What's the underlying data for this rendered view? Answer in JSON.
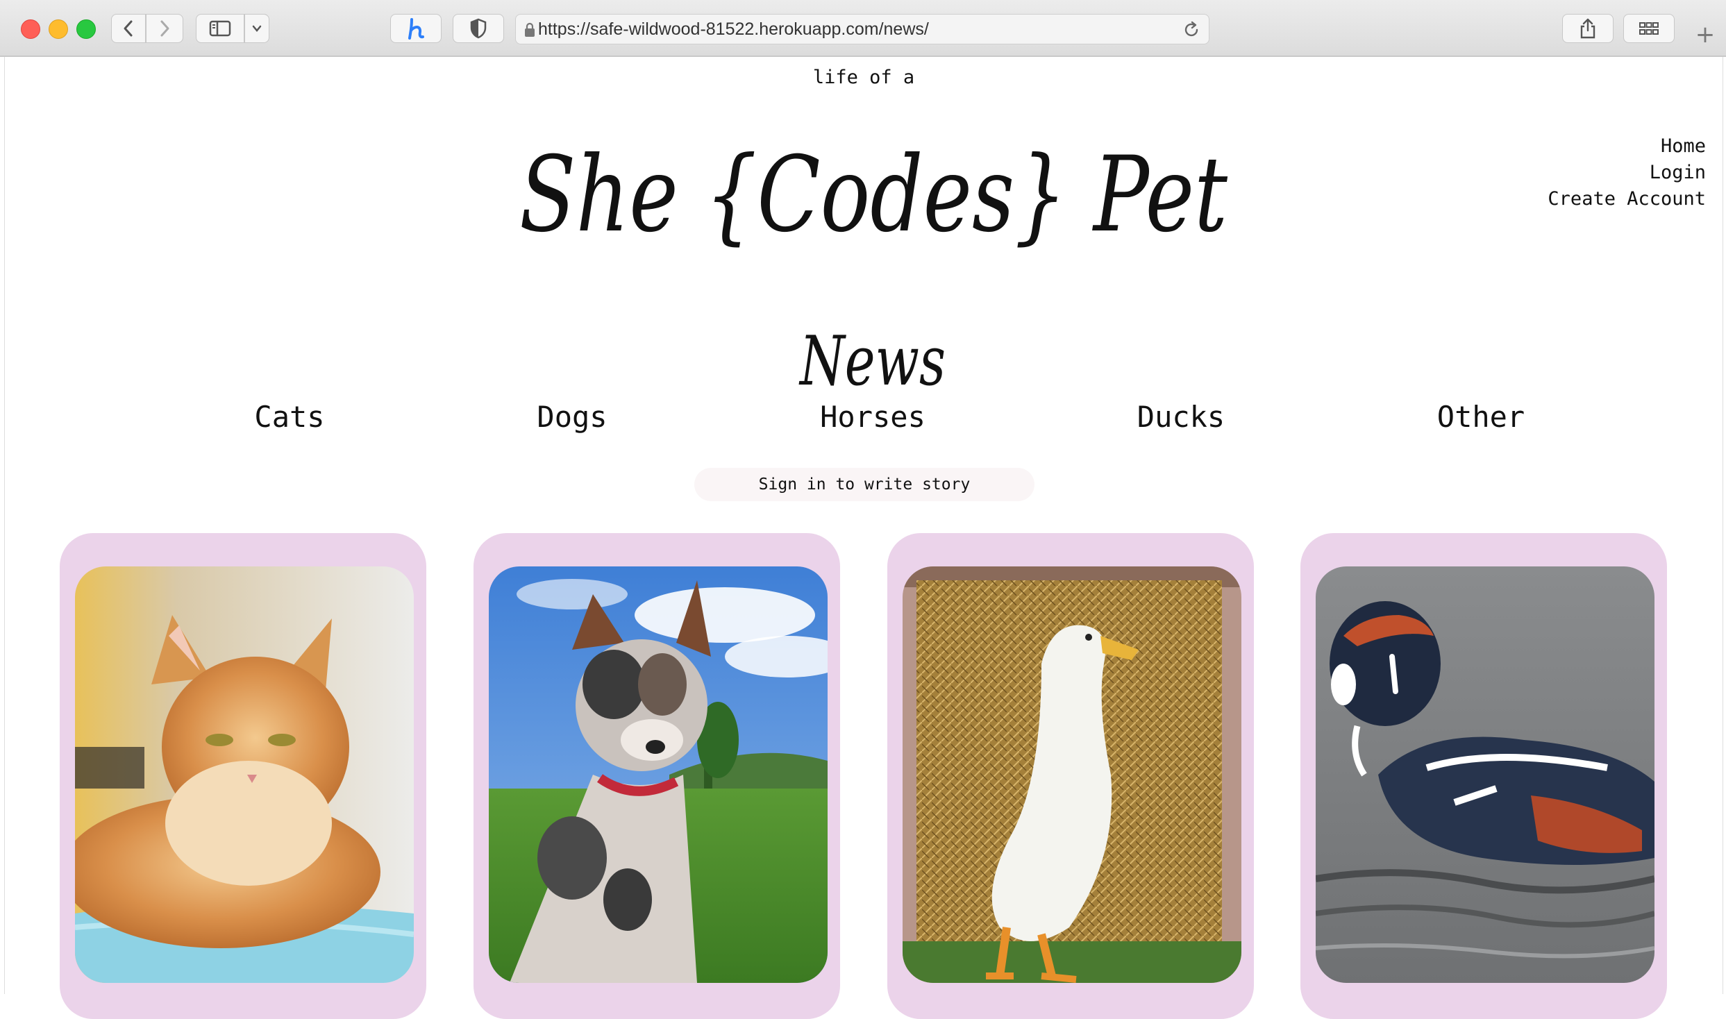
{
  "browser": {
    "url": "https://safe-wildwood-81522.herokuapp.com/news/",
    "new_tab_symbol": "+"
  },
  "site": {
    "tagline": "life of a",
    "logo_text": "She {Codes} Pet",
    "nav": [
      "Home",
      "Login",
      "Create Account"
    ]
  },
  "page": {
    "heading": "News",
    "categories": [
      "Cats",
      "Dogs",
      "Horses",
      "Ducks",
      "Other"
    ],
    "sign_in_label": "Sign in to write story"
  },
  "cards": [
    {
      "subject": "cat-photo"
    },
    {
      "subject": "dog-photo"
    },
    {
      "subject": "duck-photo"
    },
    {
      "subject": "harlequin-duck-photo"
    }
  ],
  "colors": {
    "card_background": "#ebd3ea",
    "signin_background": "#faf5f6",
    "text": "#111111"
  }
}
